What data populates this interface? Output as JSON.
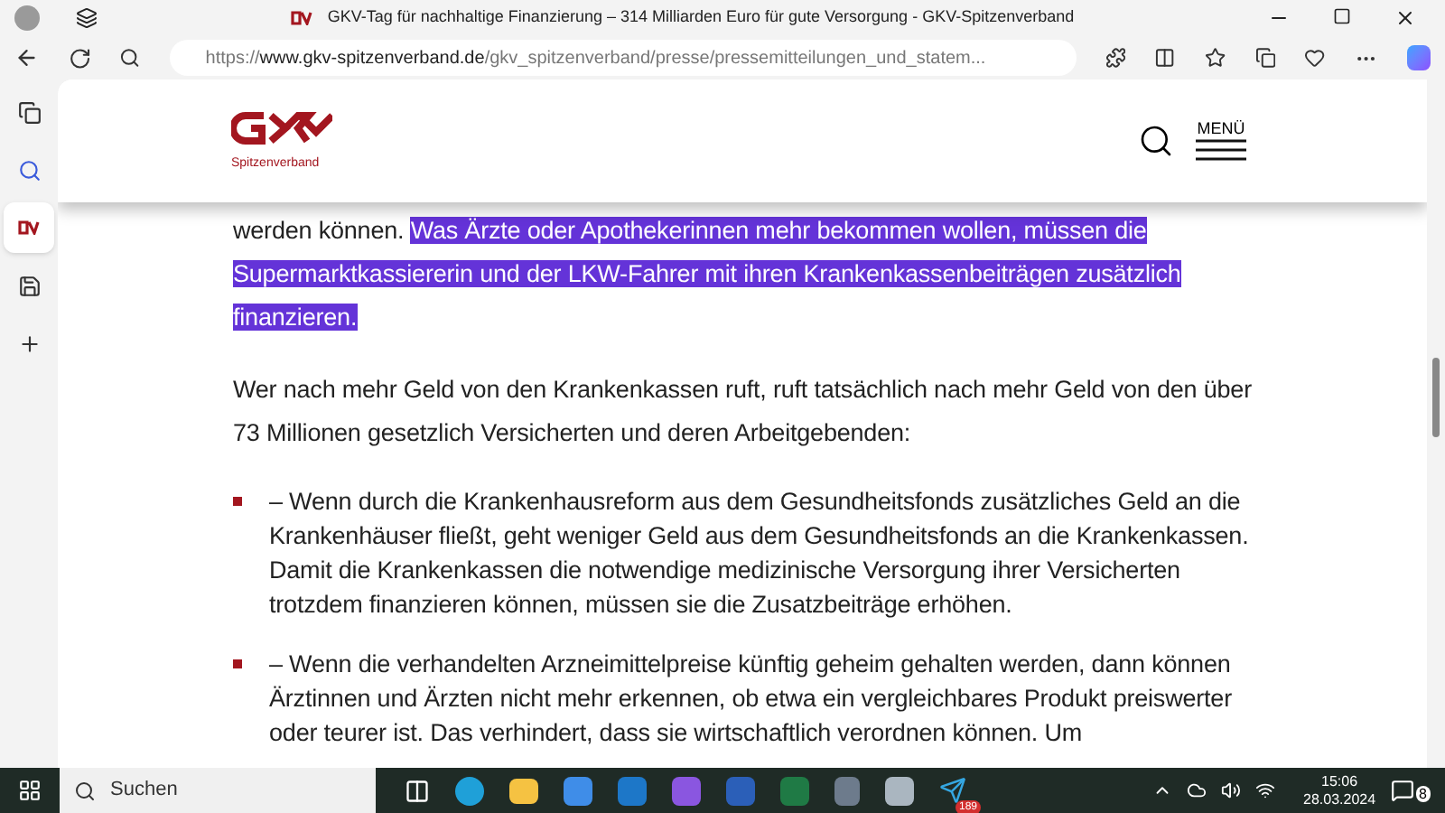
{
  "window": {
    "title": "GKV-Tag für nachhaltige Finanzierung – 314 Milliarden Euro für gute Versorgung - GKV-Spitzenverband"
  },
  "address_bar": {
    "url": "https://**www.gkv-spitzenverband.de**/gkv_spitzenverband/presse/pressemitteilungen_und_statem..."
  },
  "sidebar": {
    "items": [
      {
        "kind": "tabs",
        "selected": false
      },
      {
        "kind": "search",
        "selected": false
      },
      {
        "kind": "site",
        "selected": true
      },
      {
        "kind": "save",
        "selected": false
      },
      {
        "kind": "add",
        "selected": false
      }
    ]
  },
  "site_header": {
    "logo_text": "Spitzenverband",
    "menu_label": "MENÜ"
  },
  "article": {
    "intro_plain": "werden können.",
    "intro_selected": "Was Ärzte oder Apothekerinnen mehr bekommen wollen, müssen die Supermarktkassiererin und der LKW-Fahrer mit ihren Krankenkassenbeiträgen zusätzlich finanzieren.",
    "paragraph": "Wer nach mehr Geld von den Krankenkassen ruft, ruft tatsächlich nach mehr Geld von den über 73 Millionen gesetzlich Versicherten und deren Arbeitgebenden:",
    "bullets": [
      "– Wenn durch die Krankenhausreform aus dem Gesundheitsfonds zusätzliches Geld an die Krankenhäuser fließt, geht weniger Geld aus dem Gesundheitsfonds an die Krankenkassen. Damit die Krankenkassen die notwendige medizinische Versorgung ihrer Versicherten trotzdem finanzieren können, müssen sie die Zusatzbeiträge erhöhen.",
      "– Wenn die verhandelten Arzneimittelpreise künftig geheim gehalten werden, dann können Ärztinnen und Ärzten nicht mehr erkennen, ob etwa ein vergleichbares Produkt preiswerter oder teurer ist. Das verhindert, dass sie wirtschaftlich verordnen können. Um"
    ]
  },
  "taskbar": {
    "search_placeholder": "Suchen",
    "telegram_badge": "189",
    "time": "15:06",
    "date": "28.03.2024",
    "notifications": "8"
  }
}
